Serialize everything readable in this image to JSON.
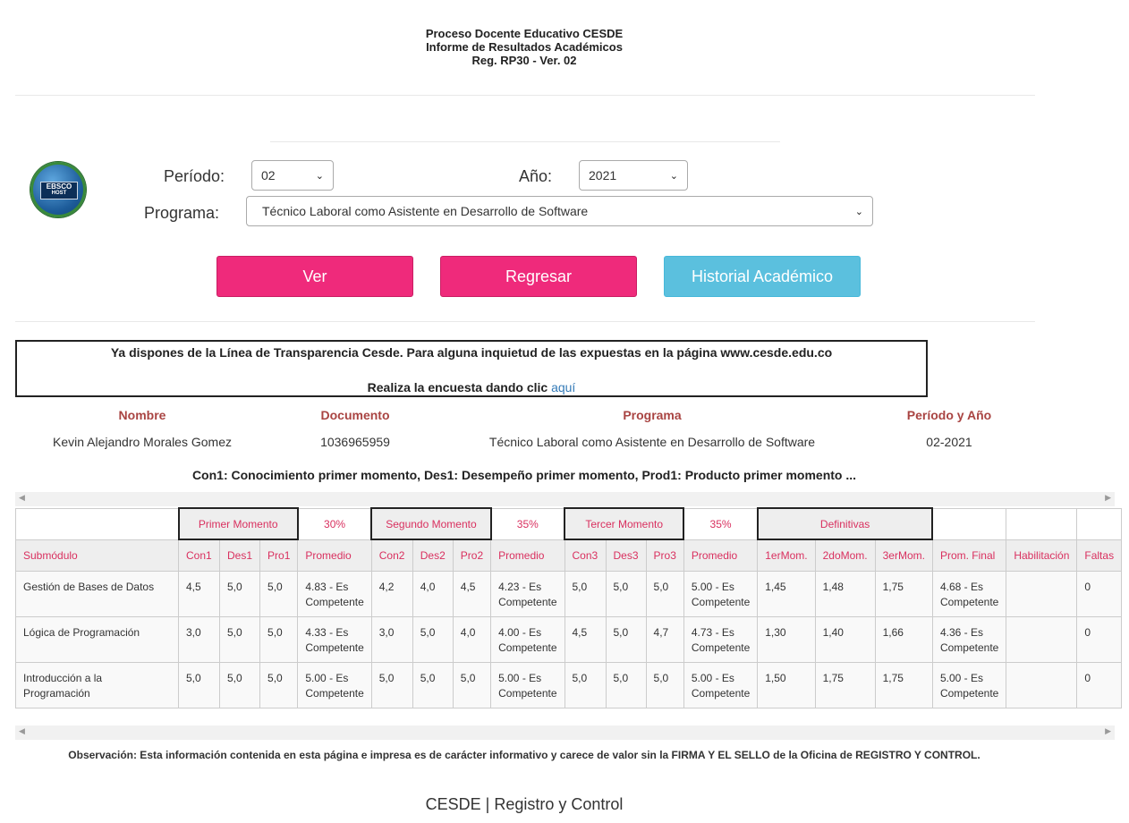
{
  "header": {
    "line1": "Proceso Docente Educativo CESDE",
    "line2": "Informe de Resultados Académicos",
    "line3": "Reg. RP30 - Ver. 02"
  },
  "logo": {
    "line1": "EBSCO",
    "line2": "HOST"
  },
  "form": {
    "periodo_label": "Período:",
    "periodo_value": "02",
    "anio_label": "Año:",
    "anio_value": "2021",
    "programa_label": "Programa:",
    "programa_value": "Técnico Laboral como Asistente en Desarrollo de Software"
  },
  "buttons": {
    "ver": "Ver",
    "regresar": "Regresar",
    "historial": "Historial Académico"
  },
  "notice": {
    "line1": "Ya dispones de la Línea de Transparencia Cesde. Para alguna inquietud de las expuestas en la página www.cesde.edu.co",
    "line2": "Realiza la encuesta dando clic",
    "link": "aquí"
  },
  "info": {
    "headers": {
      "nombre": "Nombre",
      "documento": "Documento",
      "programa": "Programa",
      "periodo": "Período y Año"
    },
    "values": {
      "nombre": "Kevin Alejandro Morales Gomez",
      "documento": "1036965959",
      "programa": "Técnico Laboral como Asistente en Desarrollo de Software",
      "periodo": "02-2021"
    }
  },
  "legend": "Con1: Conocimiento primer momento, Des1: Desempeño primer momento, Prod1: Producto primer momento ...",
  "table": {
    "moments": {
      "m1": "Primer Momento",
      "p1": "30%",
      "m2": "Segundo Momento",
      "p2": "35%",
      "m3": "Tercer Momento",
      "p3": "35%",
      "def": "Definitivas"
    },
    "columns": [
      "Submódulo",
      "Con1",
      "Des1",
      "Pro1",
      "Promedio",
      "Con2",
      "Des2",
      "Pro2",
      "Promedio",
      "Con3",
      "Des3",
      "Pro3",
      "Promedio",
      "1erMom.",
      "2doMom.",
      "3erMom.",
      "Prom. Final",
      "Habilitación",
      "Faltas"
    ],
    "rows": [
      {
        "sub": "Gestión de Bases de Datos",
        "c1": "4,5",
        "d1": "5,0",
        "p1": "5,0",
        "avg1a": "4.83 - Es",
        "avg1b": "Competente",
        "c2": "4,2",
        "d2": "4,0",
        "p2": "4,5",
        "avg2a": "4.23 - Es",
        "avg2b": "Competente",
        "c3": "5,0",
        "d3": "5,0",
        "p3": "5,0",
        "avg3a": "5.00 - Es",
        "avg3b": "Competente",
        "m1": "1,45",
        "m2": "1,48",
        "m3": "1,75",
        "fina": "4.68 - Es",
        "finb": "Competente",
        "hab": "",
        "faltas": "0"
      },
      {
        "sub": "Lógica de Programación",
        "c1": "3,0",
        "d1": "5,0",
        "p1": "5,0",
        "avg1a": "4.33 - Es",
        "avg1b": "Competente",
        "c2": "3,0",
        "d2": "5,0",
        "p2": "4,0",
        "avg2a": "4.00 - Es",
        "avg2b": "Competente",
        "c3": "4,5",
        "d3": "5,0",
        "p3": "4,7",
        "avg3a": "4.73 - Es",
        "avg3b": "Competente",
        "m1": "1,30",
        "m2": "1,40",
        "m3": "1,66",
        "fina": "4.36 - Es",
        "finb": "Competente",
        "hab": "",
        "faltas": "0"
      },
      {
        "sub": "Introducción a la Programación",
        "c1": "5,0",
        "d1": "5,0",
        "p1": "5,0",
        "avg1a": "5.00 - Es",
        "avg1b": "Competente",
        "c2": "5,0",
        "d2": "5,0",
        "p2": "5,0",
        "avg2a": "5.00 - Es",
        "avg2b": "Competente",
        "c3": "5,0",
        "d3": "5,0",
        "p3": "5,0",
        "avg3a": "5.00 - Es",
        "avg3b": "Competente",
        "m1": "1,50",
        "m2": "1,75",
        "m3": "1,75",
        "fina": "5.00 - Es",
        "finb": "Competente",
        "hab": "",
        "faltas": "0"
      }
    ]
  },
  "observation": "Observación: Esta información contenida en esta página e impresa es de carácter informativo y carece de valor sin la FIRMA Y EL SELLO de la Oficina de REGISTRO Y CONTROL.",
  "footer": "CESDE | Registro y Control",
  "colors": {
    "pink": "#ef2a7b",
    "blue": "#5bc0de",
    "label_red": "#a94442",
    "table_red": "#d9305f"
  },
  "icons": {
    "select_arrow": "chevron-down-icon",
    "scroll_left": "arrow-left-icon",
    "scroll_right": "arrow-right-icon"
  }
}
